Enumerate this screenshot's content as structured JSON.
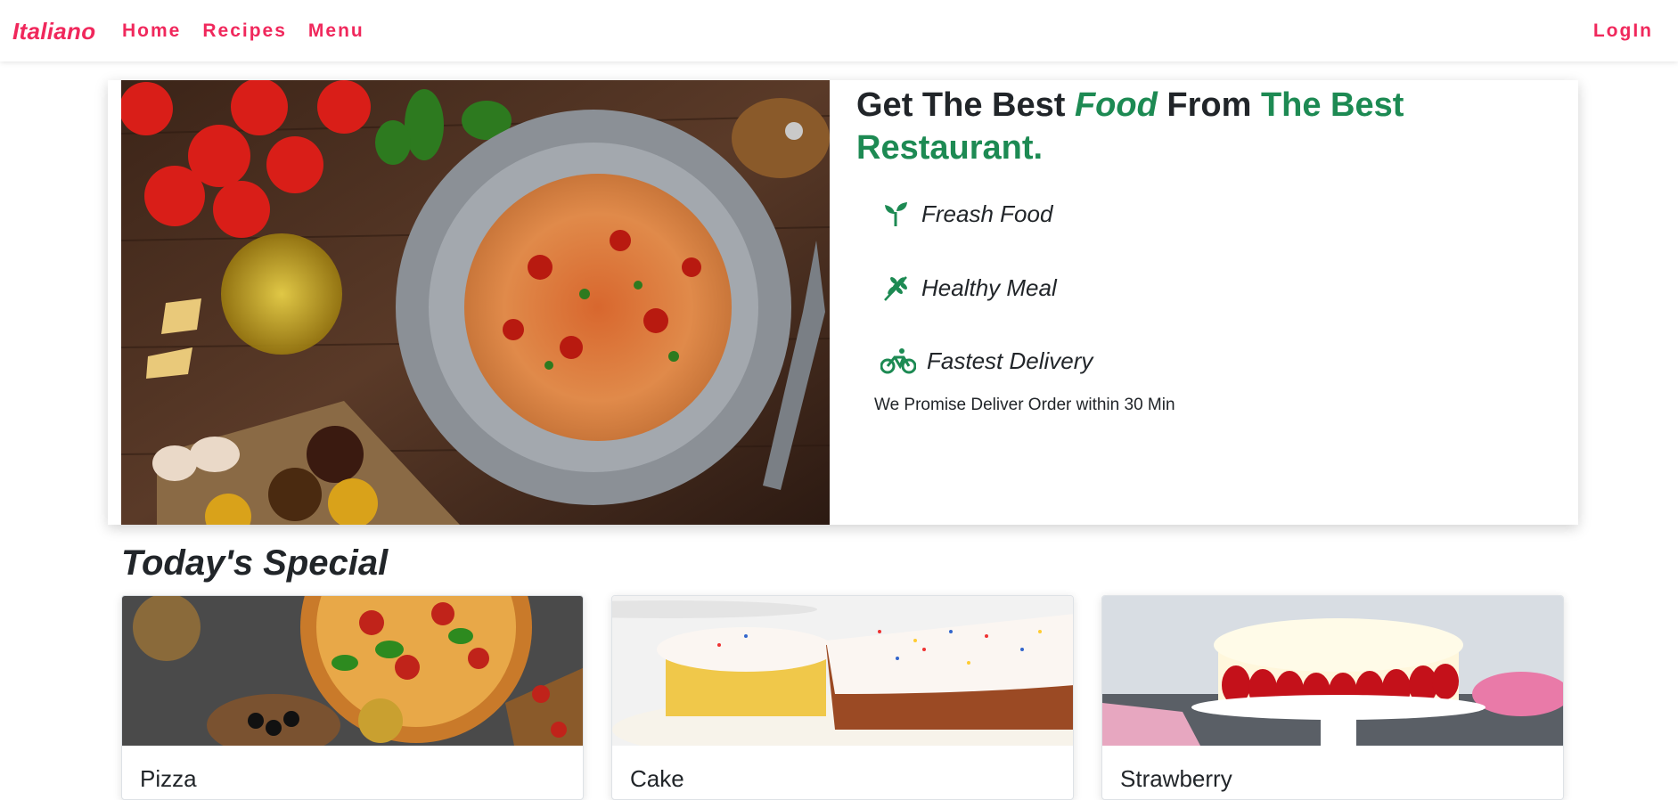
{
  "nav": {
    "brand": "Italiano",
    "links": [
      "Home",
      "Recipes",
      "Menu"
    ],
    "login": "LogIn"
  },
  "hero": {
    "title_part1": "Get The Best ",
    "title_food": "Food",
    "title_part2": " From ",
    "title_best": "The Best Restaurant.",
    "features": [
      {
        "label": "Freash Food",
        "icon": "sprout-icon"
      },
      {
        "label": "Healthy Meal",
        "icon": "wheat-icon"
      },
      {
        "label": "Fastest Delivery",
        "icon": "bicycle-icon"
      }
    ],
    "promise": "We Promise Deliver Order within 30 Min"
  },
  "special": {
    "title": "Today's Special",
    "cards": [
      {
        "title": "Pizza"
      },
      {
        "title": "Cake"
      },
      {
        "title": "Strawberry"
      }
    ]
  },
  "colors": {
    "brand": "#f0285c",
    "accent_green": "#1d8a53"
  }
}
